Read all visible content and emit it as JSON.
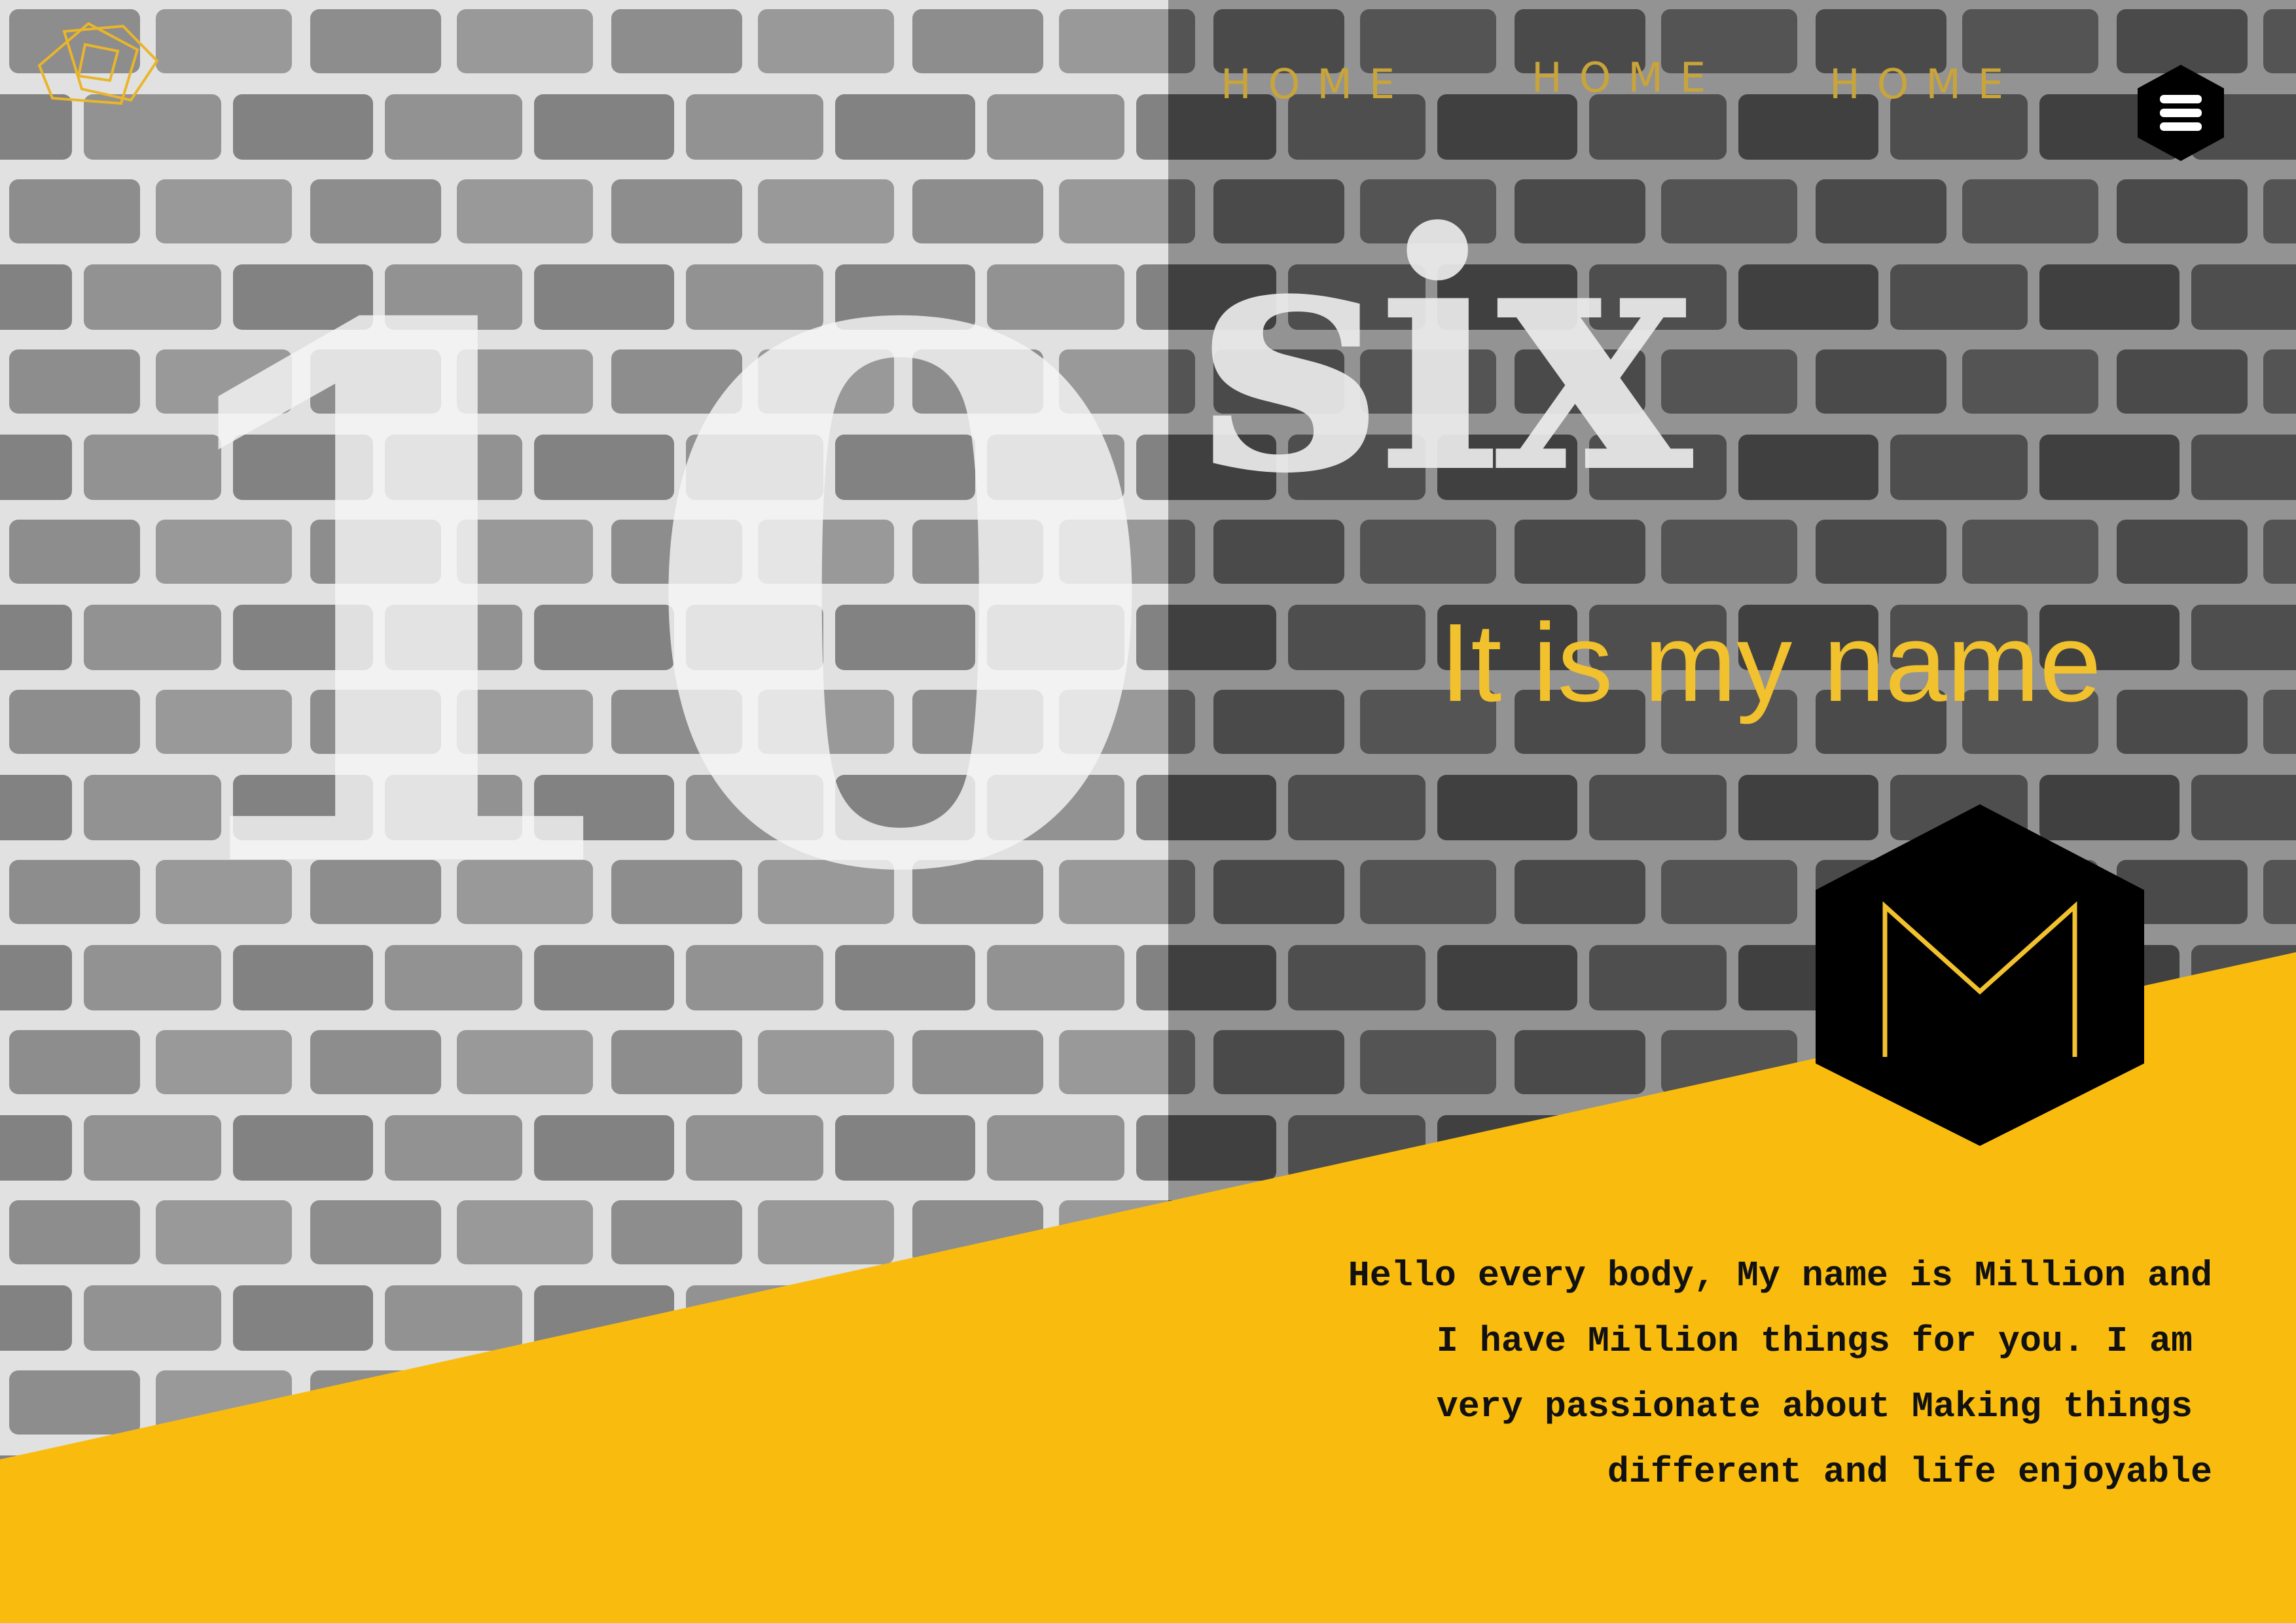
{
  "nav": {
    "items": [
      "HOME",
      "HOME",
      "HOME"
    ]
  },
  "icons": {
    "logo": "geometric-logo-icon",
    "menu": "hamburger-menu-icon",
    "badge": "m-monogram-icon"
  },
  "hero": {
    "big_number": "10",
    "word": "six",
    "tagline": "It is my name",
    "monogram": "M"
  },
  "intro": {
    "lines": [
      "Hello every body, My name is Million and",
      "I have Million things for you. I am",
      "very passionate about Making things",
      "different and life enjoyable"
    ]
  },
  "colors": {
    "accent": "#f9bc0e",
    "accent_text": "#f2c12e",
    "nav_text": "#c8a43a",
    "dark": "#000000"
  }
}
